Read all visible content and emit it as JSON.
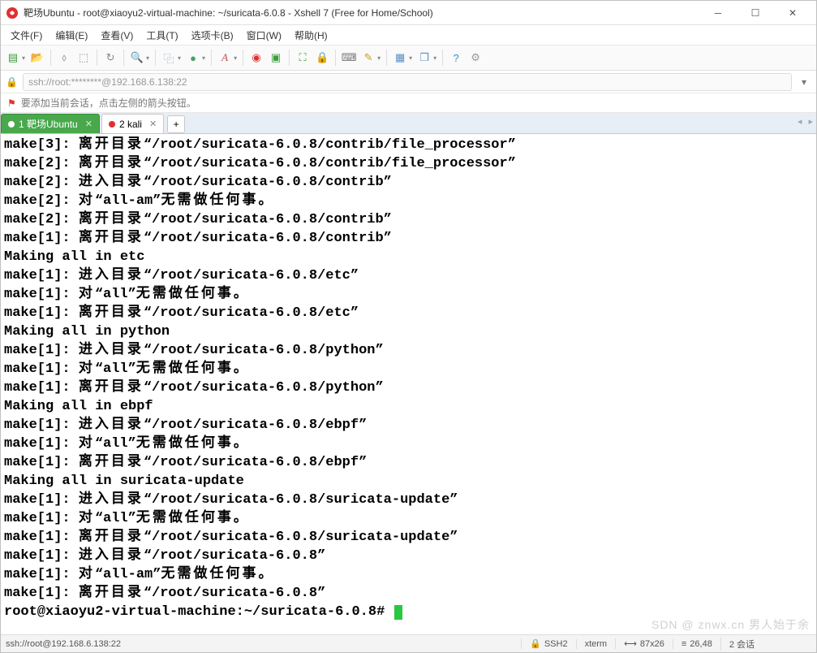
{
  "window": {
    "title": "靶场Ubuntu - root@xiaoyu2-virtual-machine: ~/suricata-6.0.8 - Xshell 7 (Free for Home/School)"
  },
  "menu": {
    "file": "文件(F)",
    "edit": "编辑(E)",
    "view": "查看(V)",
    "tools": "工具(T)",
    "tab": "选项卡(B)",
    "window": "窗口(W)",
    "help": "帮助(H)"
  },
  "address": {
    "value": "ssh://root:********@192.168.6.138:22"
  },
  "hint": {
    "text": "要添加当前会话，点击左侧的箭头按钮。"
  },
  "tabs": [
    {
      "label": "1 靶场Ubuntu",
      "active": true,
      "dot": "#ffffff"
    },
    {
      "label": "2 kali",
      "active": false,
      "dot": "#e03030"
    }
  ],
  "terminal": {
    "lines": [
      "make[3]: 离开目录“/root/suricata-6.0.8/contrib/file_processor”",
      "make[2]: 离开目录“/root/suricata-6.0.8/contrib/file_processor”",
      "make[2]: 进入目录“/root/suricata-6.0.8/contrib”",
      "make[2]: 对“all-am”无需做任何事。",
      "make[2]: 离开目录“/root/suricata-6.0.8/contrib”",
      "make[1]: 离开目录“/root/suricata-6.0.8/contrib”",
      "Making all in etc",
      "make[1]: 进入目录“/root/suricata-6.0.8/etc”",
      "make[1]: 对“all”无需做任何事。",
      "make[1]: 离开目录“/root/suricata-6.0.8/etc”",
      "Making all in python",
      "make[1]: 进入目录“/root/suricata-6.0.8/python”",
      "make[1]: 对“all”无需做任何事。",
      "make[1]: 离开目录“/root/suricata-6.0.8/python”",
      "Making all in ebpf",
      "make[1]: 进入目录“/root/suricata-6.0.8/ebpf”",
      "make[1]: 对“all”无需做任何事。",
      "make[1]: 离开目录“/root/suricata-6.0.8/ebpf”",
      "Making all in suricata-update",
      "make[1]: 进入目录“/root/suricata-6.0.8/suricata-update”",
      "make[1]: 对“all”无需做任何事。",
      "make[1]: 离开目录“/root/suricata-6.0.8/suricata-update”",
      "make[1]: 进入目录“/root/suricata-6.0.8”",
      "make[1]: 对“all-am”无需做任何事。",
      "make[1]: 离开目录“/root/suricata-6.0.8”"
    ],
    "prompt": "root@xiaoyu2-virtual-machine:~/suricata-6.0.8# "
  },
  "status": {
    "left": "ssh://root@192.168.6.138:22",
    "proto": "SSH2",
    "term": "xterm",
    "size": "87x26",
    "pos": "26,48",
    "sess": "2 会话"
  },
  "watermark": "SDN @ znwx.cn 男人始于余"
}
